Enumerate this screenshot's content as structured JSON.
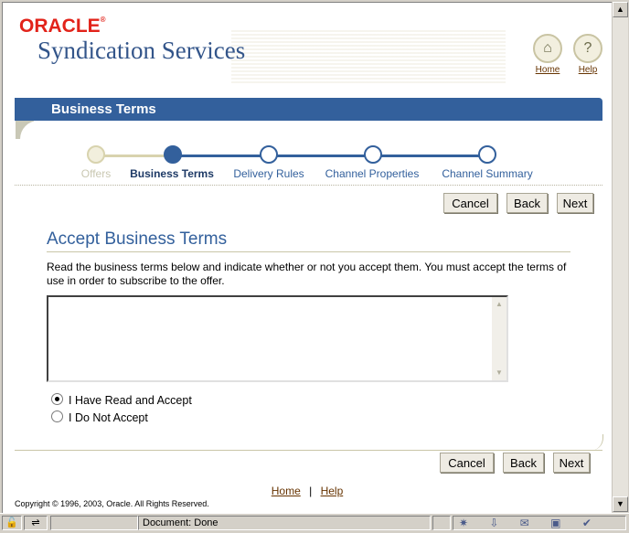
{
  "branding": {
    "vendor": "ORACLE",
    "app_name": "Syndication Services"
  },
  "global_links": {
    "home_label": "Home",
    "help_label": "Help"
  },
  "page": {
    "title": "Business Terms"
  },
  "train": {
    "steps": [
      {
        "label": "Offers",
        "state": "visited"
      },
      {
        "label": "Business Terms",
        "state": "current"
      },
      {
        "label": "Delivery Rules",
        "state": "next"
      },
      {
        "label": "Channel Properties",
        "state": "next"
      },
      {
        "label": "Channel Summary",
        "state": "next"
      }
    ]
  },
  "buttons": {
    "cancel": "Cancel",
    "back": "Back",
    "next": "Next"
  },
  "section": {
    "heading": "Accept Business Terms",
    "instructions": "Read the business terms below and indicate whether or not you accept them. You must accept the terms of use in order to subscribe to the offer.",
    "terms_text": ""
  },
  "acceptance": {
    "options": [
      {
        "label": "I Have Read and Accept",
        "selected": true
      },
      {
        "label": "I Do Not Accept",
        "selected": false
      }
    ]
  },
  "footer": {
    "home": "Home",
    "separator": "|",
    "help": "Help",
    "copyright": "Copyright © 1996, 2003, Oracle. All Rights Reserved."
  },
  "statusbar": {
    "text": "Document: Done"
  },
  "colors": {
    "brand_blue": "#33609c",
    "oracle_red": "#e2231a",
    "link_brown": "#663300"
  }
}
